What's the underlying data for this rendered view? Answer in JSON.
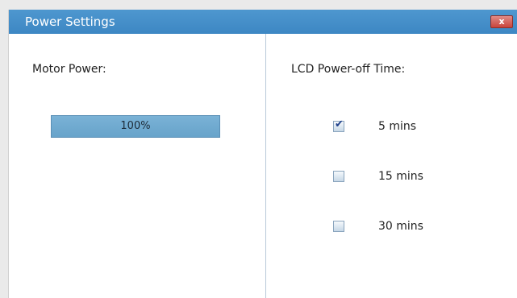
{
  "window": {
    "title": "Power Settings",
    "close_label": "x"
  },
  "motor": {
    "label": "Motor Power:",
    "value_text": "100%",
    "value_fraction": 1.0
  },
  "lcd": {
    "label": "LCD Power-off Time:",
    "options": [
      {
        "label": "5 mins",
        "checked": true
      },
      {
        "label": "15 mins",
        "checked": false
      },
      {
        "label": "30 mins",
        "checked": false
      }
    ]
  },
  "colors": {
    "titlebar": "#3d87c3",
    "progress_fill": "#6ea9cf",
    "close_button": "#c9453c"
  }
}
